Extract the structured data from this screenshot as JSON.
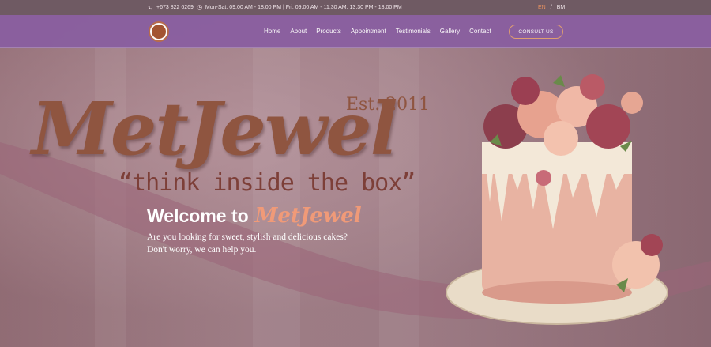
{
  "topbar": {
    "phone": "+673 822 6269",
    "hours": "Mon-Sat: 09:00 AM - 18:00 PM | Fri: 09:00 AM - 11:30 AM, 13:30 PM - 18:00 PM",
    "lang_en": "EN",
    "lang_sep": "/",
    "lang_bm": "BM"
  },
  "nav": {
    "items": [
      "Home",
      "About",
      "Products",
      "Appointment",
      "Testimonials",
      "Gallery",
      "Contact"
    ],
    "cta": "CONSULT US"
  },
  "hero": {
    "brand": "MetJewel",
    "est": "Est. 2011",
    "tagline": "“think inside the box”",
    "welcome_prefix": "Welcome to",
    "welcome_brand": "MetJewel",
    "sub_line1": "Are you looking for sweet, stylish and delicious cakes?",
    "sub_line2": "Don't worry, we can help you."
  },
  "colors": {
    "nav_bg": "#8a5fa0",
    "accent": "#e59060",
    "brand_text": "#8f5540"
  }
}
